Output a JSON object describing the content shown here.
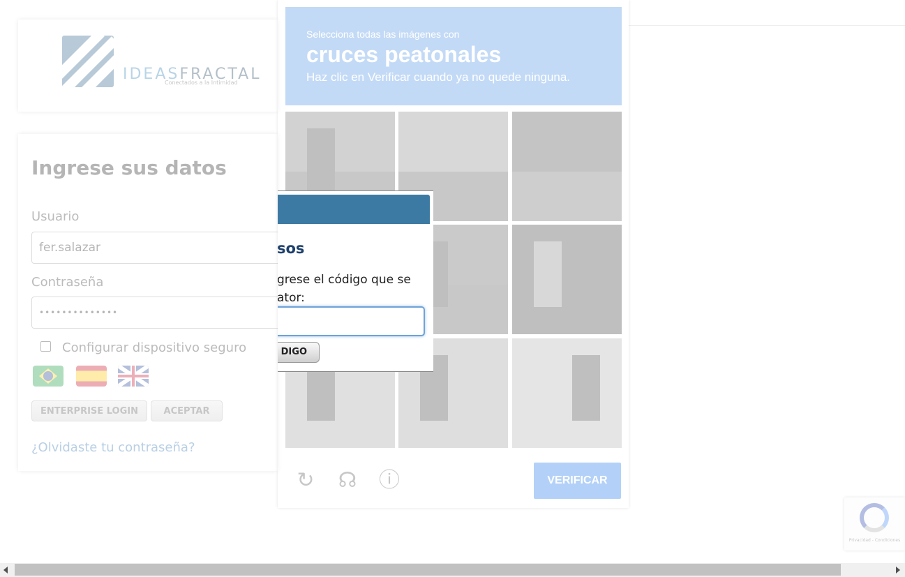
{
  "logo": {
    "brand_a": "IDEAS",
    "brand_b": "FRACTAL",
    "tagline": "Conectados a la Intimidad"
  },
  "login": {
    "title": "Ingrese sus datos",
    "user_label": "Usuario",
    "user_value": "fer.salazar",
    "password_label": "Contraseña",
    "password_value": "••••••••••••••",
    "trusted_device_label": "Configurar dispositivo seguro",
    "enterprise_button": "ENTERPRISE LOGIN",
    "accept_button": "ACEPTAR",
    "forgot_link": "¿Olvidaste tu contraseña?",
    "flags": [
      "brazil-flag",
      "spain-flag",
      "uk-flag"
    ]
  },
  "captcha": {
    "subtitle": "Selecciona todas las imágenes con",
    "target": "cruces peatonales",
    "instruction": "Haz clic en Verificar cuando ya no quede ninguna.",
    "verify_button": "VERIFICAR",
    "accent_color": "#4a90e2",
    "icons": [
      "reload-icon",
      "headphones-icon",
      "info-icon"
    ],
    "badge_text": "Privacidad - Condiciones"
  },
  "modal": {
    "title_fragment": "sos",
    "text_line1": "grese el código que se",
    "text_line2": "ator:",
    "input_value": "",
    "button_fragment": "DIGO",
    "header_color": "#3d7aa3"
  }
}
